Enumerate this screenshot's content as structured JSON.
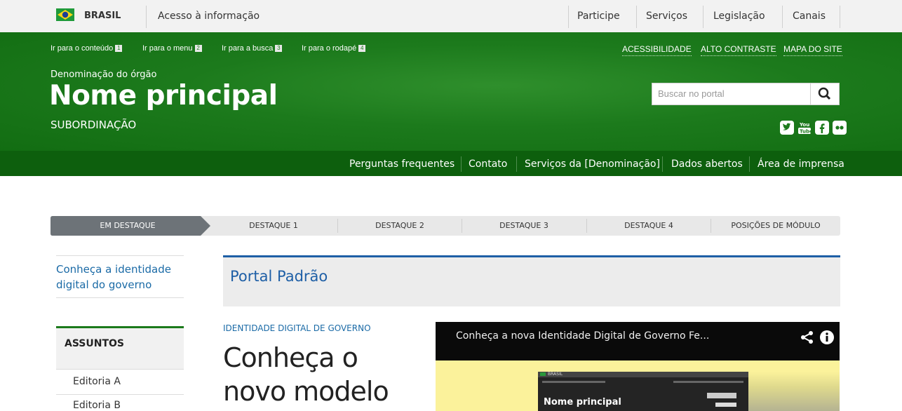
{
  "gov_bar": {
    "brasil": "BRASIL",
    "acesso": "Acesso à informação",
    "links": [
      "Participe",
      "Serviços",
      "Legislação",
      "Canais"
    ]
  },
  "skip_links": [
    {
      "label": "Ir para o conteúdo",
      "key": "1"
    },
    {
      "label": "Ir para o menu",
      "key": "2"
    },
    {
      "label": "Ir para a busca",
      "key": "3"
    },
    {
      "label": "Ir para o rodapé",
      "key": "4"
    }
  ],
  "top_links": [
    "ACESSIBILIDADE",
    "ALTO CONTRASTE",
    "MAPA DO SITE"
  ],
  "header": {
    "denominacao": "Denominação do órgão",
    "nome": "Nome principal",
    "subordinacao": "SUBORDINAÇÃO"
  },
  "search": {
    "placeholder": "Buscar no portal",
    "icon": "search-icon"
  },
  "social_icons": [
    "twitter-icon",
    "youtube-icon",
    "facebook-icon",
    "flickr-icon"
  ],
  "nav": [
    "Perguntas frequentes",
    "Contato",
    "Serviços da [Denominação]",
    "Dados abertos",
    "Área de imprensa"
  ],
  "tabs": [
    "EM DESTAQUE",
    "DESTAQUE 1",
    "DESTAQUE 2",
    "DESTAQUE 3",
    "DESTAQUE 4",
    "POSIÇÕES DE MÓDULO"
  ],
  "sidebar": {
    "identidade_link": "Conheça a identidade digital do governo",
    "assuntos": "ASSUNTOS",
    "items": [
      "Editoria A",
      "Editoria B"
    ]
  },
  "main": {
    "portal_title": "Portal Padrão",
    "kicker": "IDENTIDADE DIGITAL DE GOVERNO",
    "headline_1": "Conheça o",
    "headline_2": "novo modelo"
  },
  "video": {
    "title": "Conheça a nova Identidade Digital de Governo Fe...",
    "thumb_brasil": "BRASIL",
    "thumb_title": "Nome principal"
  },
  "colors": {
    "green": "#1c7a1c",
    "dark_green": "#0d5f0d",
    "blue": "#1e5fa6",
    "link": "#1a6aa6"
  }
}
